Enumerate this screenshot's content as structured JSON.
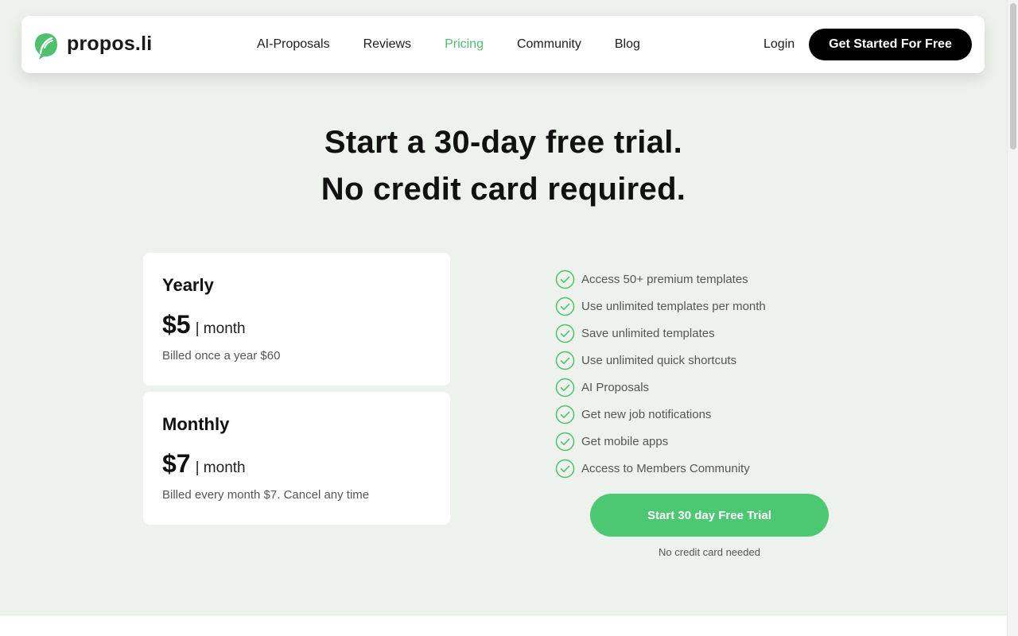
{
  "brand": {
    "name": "propos.li",
    "logo_icon": "leaf-logo-icon",
    "accent_color": "#4fc06e"
  },
  "nav": {
    "items": [
      {
        "label": "AI-Proposals",
        "active": false
      },
      {
        "label": "Reviews",
        "active": false
      },
      {
        "label": "Pricing",
        "active": true
      },
      {
        "label": "Community",
        "active": false
      },
      {
        "label": "Blog",
        "active": false
      }
    ],
    "login_label": "Login",
    "cta_label": "Get Started For Free"
  },
  "hero": {
    "line1": "Start a 30-day free trial.",
    "line2": "No credit card required."
  },
  "plans": [
    {
      "name": "Yearly",
      "price": "$5",
      "period": "| month",
      "billing": "Billed once a year $60"
    },
    {
      "name": "Monthly",
      "price": "$7",
      "period": "| month",
      "billing": "Billed every month $7. Cancel any time"
    }
  ],
  "features": [
    "Access 50+ premium templates",
    "Use unlimited templates per month",
    "Save unlimited templates",
    "Use unlimited quick shortcuts",
    "AI Proposals",
    "Get new job notifications",
    "Get mobile apps",
    "Access to Members Community"
  ],
  "trial": {
    "cta_label": "Start 30 day Free Trial",
    "note": "No credit card needed",
    "button_color": "#4cc872"
  }
}
